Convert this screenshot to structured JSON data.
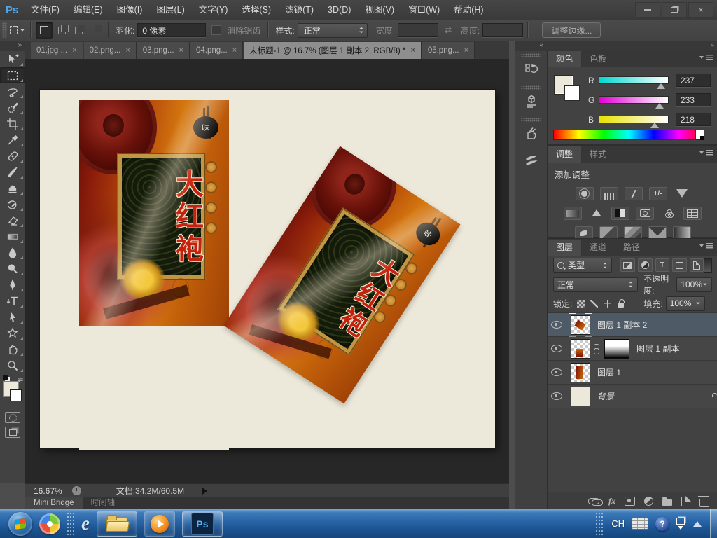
{
  "app": {
    "logo": "Ps"
  },
  "colors": {
    "canvas": "#EDE9DA",
    "accent_blue": "#4FB3F6",
    "taskbar_blue": "#2763A4"
  },
  "menu_bar": {
    "items": [
      "文件(F)",
      "编辑(E)",
      "图像(I)",
      "图层(L)",
      "文字(Y)",
      "选择(S)",
      "滤镜(T)",
      "3D(D)",
      "视图(V)",
      "窗口(W)",
      "帮助(H)"
    ],
    "close_glyph": "×"
  },
  "options_bar": {
    "feather_label": "羽化:",
    "feather_value": "0 像素",
    "antialias_label": "消除锯齿",
    "style_label": "样式:",
    "style_value": "正常",
    "width_label": "宽度:",
    "height_label": "高度:",
    "refine_edge_label": "调整边缘..."
  },
  "doc_tabs": {
    "close_glyph": "×",
    "items": [
      {
        "label": "01.jpg ..."
      },
      {
        "label": "02.png..."
      },
      {
        "label": "03.png..."
      },
      {
        "label": "04.png..."
      },
      {
        "label": "未标题-1 @ 16.7% (图层 1 副本 2, RGB/8) *"
      },
      {
        "label": "05.png..."
      }
    ]
  },
  "toolbar": {
    "collapse_glyph": "»",
    "tools": [
      "move",
      "rectangular-marquee",
      "lasso",
      "quick-selection",
      "crop",
      "eyedropper",
      "spot-healing-brush",
      "brush",
      "clone-stamp",
      "history-brush",
      "eraser",
      "gradient",
      "blur",
      "dodge",
      "pen",
      "type",
      "path-selection",
      "custom-shape",
      "hand",
      "zoom"
    ]
  },
  "panel_dock": {
    "collapse_glyph": "«",
    "right_collapse_glyph": "»"
  },
  "canvas": {
    "artwork_title": "大红袍",
    "artwork_seal": "味"
  },
  "panels": {
    "color": {
      "tab_color": "颜色",
      "tab_swatches": "色板",
      "channels": [
        {
          "label": "R",
          "value": "237"
        },
        {
          "label": "G",
          "value": "233"
        },
        {
          "label": "B",
          "value": "218"
        }
      ],
      "foreground_hex": "#EDE9DA"
    },
    "adjustments": {
      "tab_adjustments": "调整",
      "tab_styles": "样式",
      "add_label": "添加调整"
    },
    "layers": {
      "tab_layers": "图层",
      "tab_channels": "通道",
      "tab_paths": "路径",
      "filter_label": "类型",
      "blend_mode": "正常",
      "opacity_label": "不透明度:",
      "opacity_value": "100%",
      "lock_label": "锁定:",
      "fill_label": "填充:",
      "fill_value": "100%",
      "fx_label": "fx",
      "items": [
        {
          "name": "图层 1 副本 2"
        },
        {
          "name": "图层 1 副本"
        },
        {
          "name": "图层 1"
        },
        {
          "name": "背景"
        }
      ]
    }
  },
  "status_bar": {
    "zoom_value": "16.67%",
    "doc_label": "文档:34.2M/60.5M"
  },
  "bottom_bar": {
    "mini_bridge": "Mini Bridge",
    "timeline": "时间轴"
  },
  "taskbar": {
    "ie_glyph": "e",
    "ps_label": "Ps",
    "tray_lang": "CH",
    "help_glyph": "?"
  }
}
